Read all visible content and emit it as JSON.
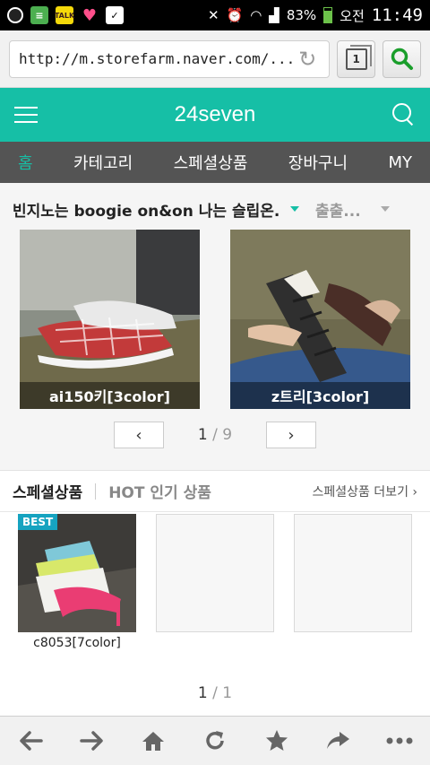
{
  "status": {
    "battery": "83%",
    "period": "오전",
    "time": "11:49"
  },
  "browser": {
    "url": "http://m.storefarm.naver.com/...",
    "tab_count": "1"
  },
  "app": {
    "title": "24seven"
  },
  "nav": {
    "items": [
      "홈",
      "카테고리",
      "스페셜상품",
      "장바구니",
      "MY"
    ]
  },
  "best": {
    "title": "빈지노는 boogie on&on 나는 슬립온...",
    "select_label": "출출...",
    "cards": [
      {
        "caption": "ai150키[3color]"
      },
      {
        "caption": "z트리[3color]"
      }
    ],
    "page": "1",
    "page_total": "/ 9"
  },
  "special": {
    "tab": "스페셜상품",
    "tab2": "HOT 인기 상품",
    "more": "스페셜상품 더보기 ›",
    "products": [
      {
        "badge": "BEST",
        "name": "c8053[7color]"
      }
    ],
    "page": "1",
    "page_total": "/ 1"
  },
  "colors": {
    "accent": "#16bfa6",
    "nav_bg": "#545454"
  },
  "icons": [
    "back-arrow-icon",
    "forward-arrow-icon",
    "home-icon",
    "refresh-icon",
    "star-icon",
    "share-icon",
    "more-icon"
  ]
}
